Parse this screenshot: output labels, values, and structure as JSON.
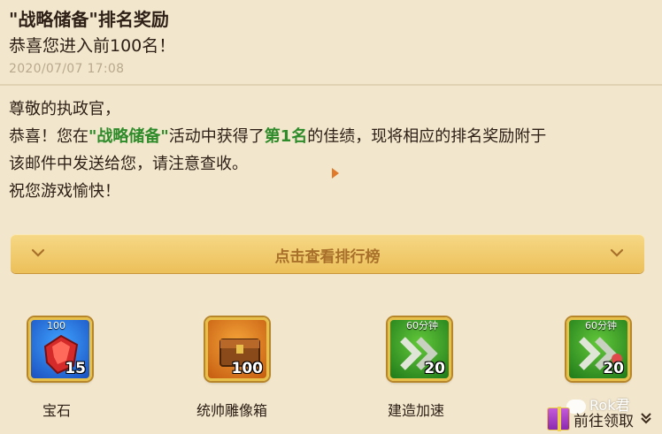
{
  "mail": {
    "title": "\"战略储备\"排名奖励",
    "subtitle": "恭喜您进入前100名！",
    "timestamp": "2020/07/07 17:08"
  },
  "body": {
    "greeting": "尊敬的执政官，",
    "line1_a": "恭喜！您在",
    "event_name": "\"战略储备\"",
    "line1_b": "活动中获得了",
    "rank": "第1名",
    "line1_c": "的佳绩，现将相应的排名奖励附于",
    "line2": "该邮件中发送给您，请注意查收。",
    "closing": "祝您游戏愉快！"
  },
  "ranking_button": {
    "label": "点击查看排行榜"
  },
  "rewards": [
    {
      "name": "宝石",
      "tag": "100",
      "count": "15",
      "icon": "gem-icon",
      "color": "#1a4fc0"
    },
    {
      "name": "统帅雕像箱",
      "tag": "",
      "count": "100",
      "icon": "chest-icon",
      "color": "#c55c10"
    },
    {
      "name": "建造加速",
      "tag": "60分钟",
      "count": "20",
      "icon": "speedup-icon",
      "color": "#1f7a1a"
    },
    {
      "name": "",
      "tag": "60分钟",
      "count": "20",
      "icon": "speedup-icon",
      "color": "#1f7a1a"
    }
  ],
  "claim": {
    "label": "前往领取"
  },
  "watermark": {
    "text": "Rok君"
  },
  "colors": {
    "background": "#f2e6cc",
    "highlight": "#2e8b2a",
    "button": "#ecc05a"
  }
}
